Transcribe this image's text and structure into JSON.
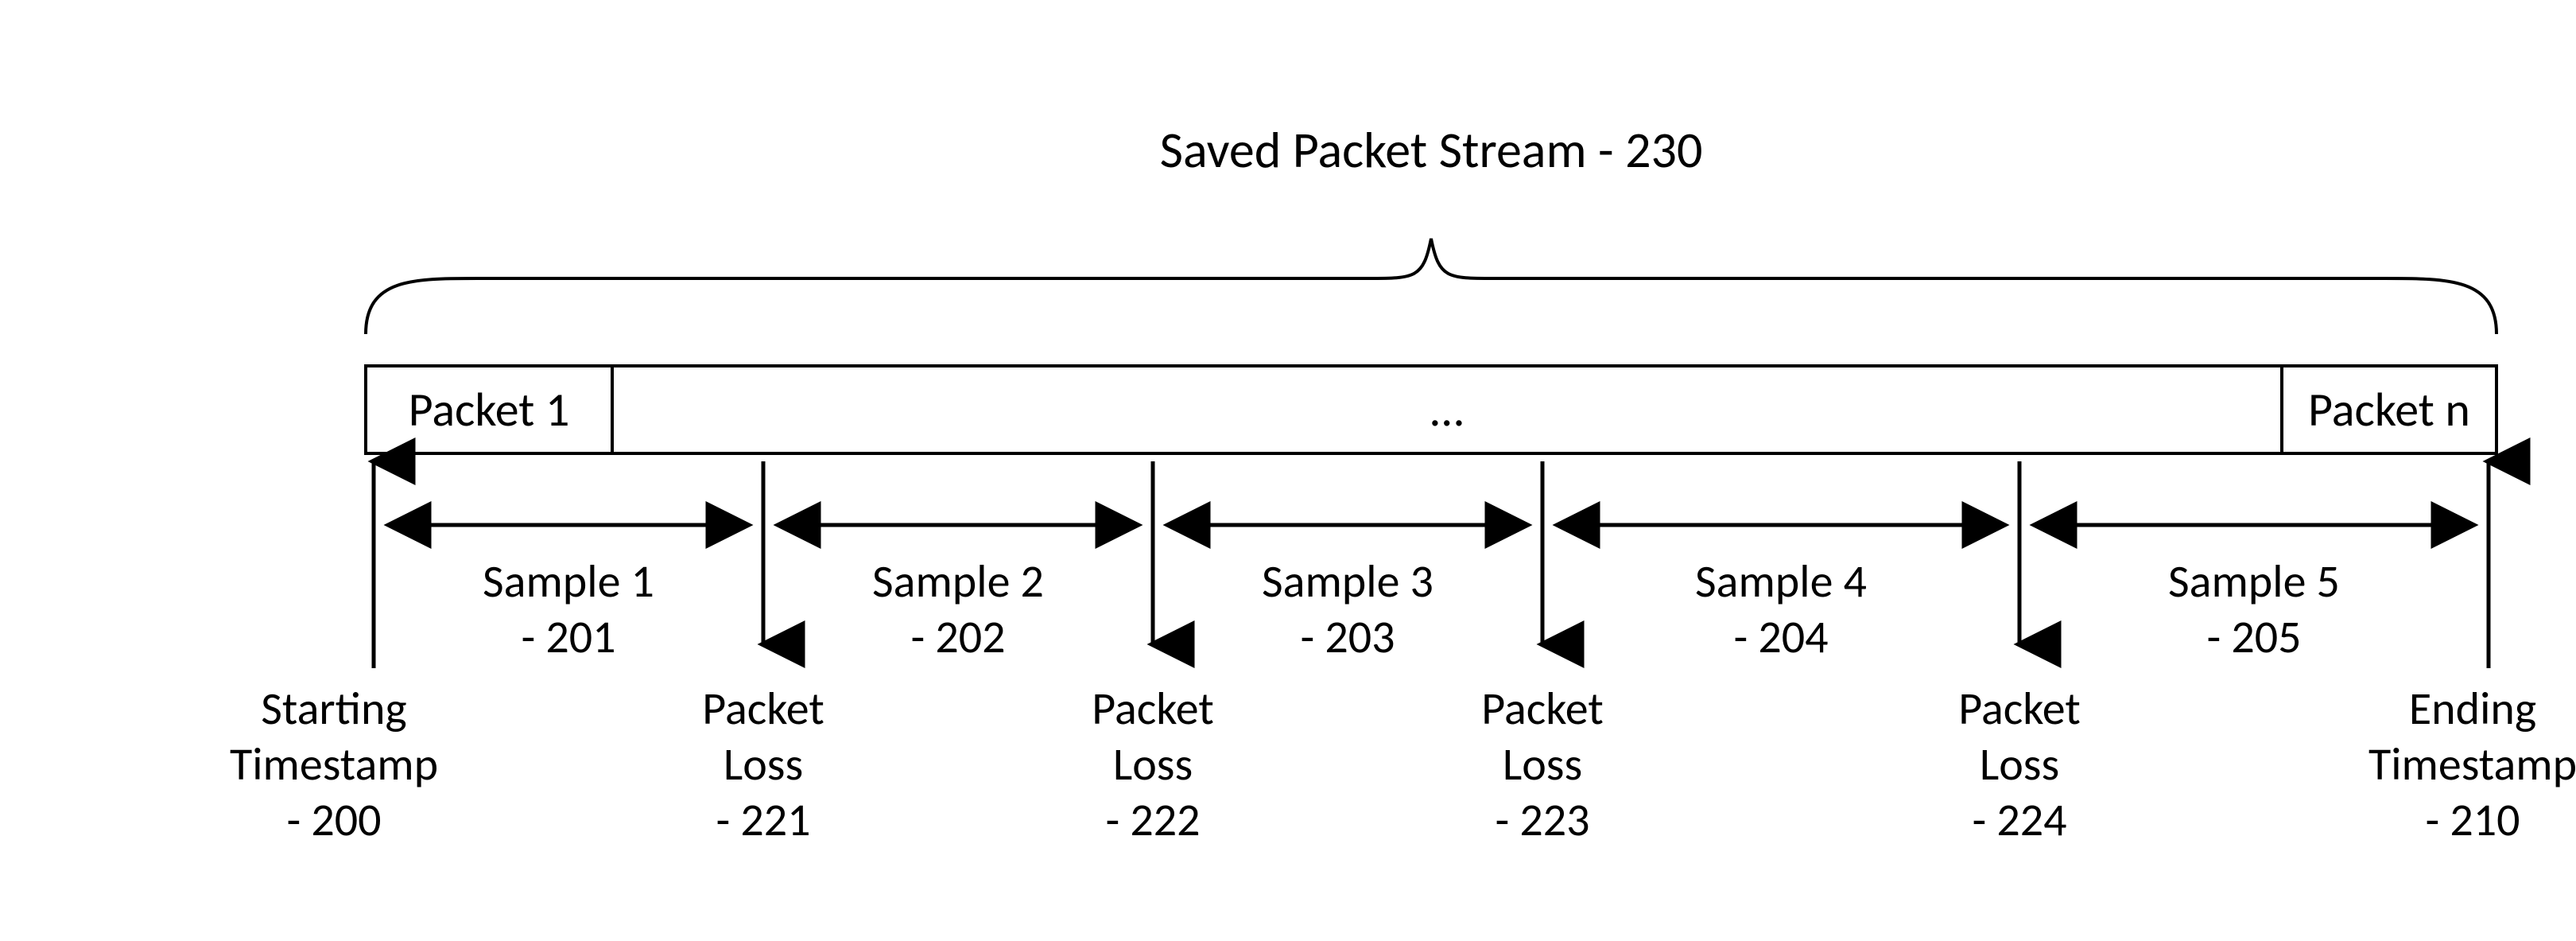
{
  "title": "Saved Packet Stream - 230",
  "cells": {
    "first": "Packet 1",
    "middle": "…",
    "last": "Packet n"
  },
  "start": {
    "l1": "Starting",
    "l2": "Timestamp",
    "l3": "- 200"
  },
  "end": {
    "l1": "Ending",
    "l2": "Timestamp",
    "l3": "- 210"
  },
  "samples": [
    {
      "name": "Sample 1",
      "ref": "- 201"
    },
    {
      "name": "Sample 2",
      "ref": "- 202"
    },
    {
      "name": "Sample 3",
      "ref": "- 203"
    },
    {
      "name": "Sample 4",
      "ref": "- 204"
    },
    {
      "name": "Sample 5",
      "ref": "- 205"
    }
  ],
  "losses": [
    {
      "l1": "Packet",
      "l2": "Loss",
      "ref": "- 221"
    },
    {
      "l1": "Packet",
      "l2": "Loss",
      "ref": "- 222"
    },
    {
      "l1": "Packet",
      "l2": "Loss",
      "ref": "- 223"
    },
    {
      "l1": "Packet",
      "l2": "Loss",
      "ref": "- 224"
    }
  ]
}
